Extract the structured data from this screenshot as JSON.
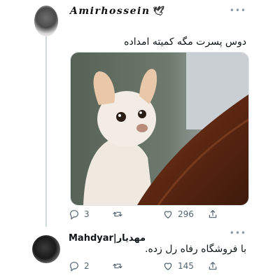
{
  "tweet": {
    "author_name": "Amirhossein",
    "text": "دوس پسرت مگه کمیته امداده",
    "stats": {
      "replies": "3",
      "retweets": "",
      "likes": "296"
    }
  },
  "reply": {
    "author_name": "Mahdyar|مهدیار",
    "text": "با فروشگاه رفاه رل زده.",
    "stats": {
      "replies": "2",
      "retweets": "",
      "likes": "145"
    }
  },
  "icons": {
    "more": "more-icon",
    "reply": "reply-icon",
    "retweet": "retweet-icon",
    "like": "heart-icon",
    "share": "share-icon",
    "name_emblem": "bird-icon"
  },
  "colors": {
    "text": "#0f1419",
    "muted": "#536471",
    "thread_line": "#cfd9de"
  }
}
